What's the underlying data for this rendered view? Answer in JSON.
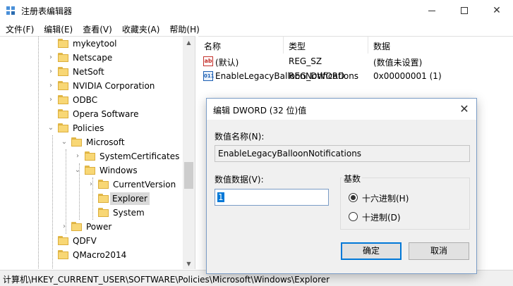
{
  "window": {
    "title": "注册表编辑器"
  },
  "menu": [
    "文件(F)",
    "编辑(E)",
    "查看(V)",
    "收藏夹(A)",
    "帮助(H)"
  ],
  "tree": {
    "items": [
      {
        "label": "mykeytool",
        "expand": ""
      },
      {
        "label": "Netscape",
        "expand": "›"
      },
      {
        "label": "NetSoft",
        "expand": "›"
      },
      {
        "label": "NVIDIA Corporation",
        "expand": "›"
      },
      {
        "label": "ODBC",
        "expand": "›"
      },
      {
        "label": "Opera Software",
        "expand": ""
      },
      {
        "label": "Policies",
        "expand": "⌄"
      },
      {
        "label": "Microsoft",
        "expand": "⌄"
      },
      {
        "label": "SystemCertificates",
        "expand": "›"
      },
      {
        "label": "Windows",
        "expand": "⌄"
      },
      {
        "label": "CurrentVersion",
        "expand": "›"
      },
      {
        "label": "Explorer",
        "expand": ""
      },
      {
        "label": "System",
        "expand": ""
      },
      {
        "label": "Power",
        "expand": "›"
      },
      {
        "label": "QDFV",
        "expand": ""
      },
      {
        "label": "QMacro2014",
        "expand": ""
      }
    ]
  },
  "list": {
    "headers": {
      "name": "名称",
      "type": "类型",
      "data": "数据"
    },
    "rows": [
      {
        "icon": "ab",
        "name": "(默认)",
        "type": "REG_SZ",
        "data": "(数值未设置)"
      },
      {
        "icon": "011",
        "name": "EnableLegacyBalloonNotifications",
        "type": "REG_DWORD",
        "data": "0x00000001 (1)"
      }
    ]
  },
  "status": {
    "path": "计算机\\HKEY_CURRENT_USER\\SOFTWARE\\Policies\\Microsoft\\Windows\\Explorer"
  },
  "dialog": {
    "title": "编辑 DWORD (32 位)值",
    "name_label": "数值名称(N):",
    "name_value": "EnableLegacyBalloonNotifications",
    "data_label": "数值数据(V):",
    "data_value": "1",
    "base_label": "基数",
    "radio_hex": "十六进制(H)",
    "radio_dec": "十进制(D)",
    "ok": "确定",
    "cancel": "取消"
  },
  "colors": {
    "accent": "#0078d7",
    "folder": "#f8d775"
  }
}
